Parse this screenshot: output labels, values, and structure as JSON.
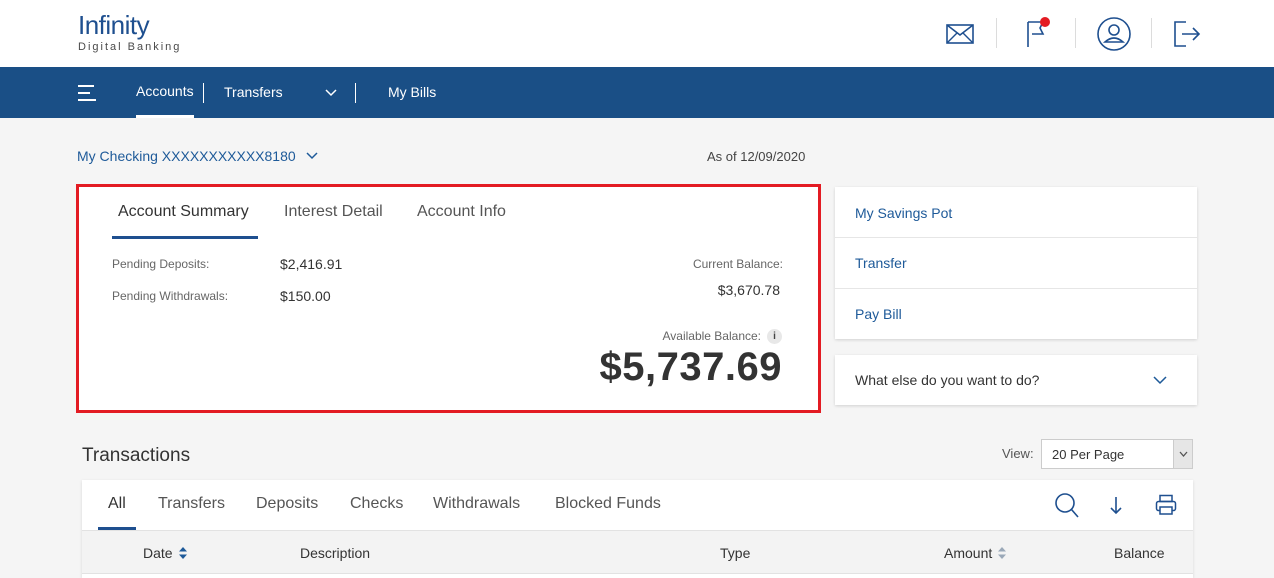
{
  "brand": {
    "name": "Infinity",
    "tagline": "Digital Banking"
  },
  "header_icons": [
    "mail-icon",
    "flag-icon",
    "user-icon",
    "logout-icon"
  ],
  "colors": {
    "primary": "#1a4f86",
    "link": "#1e5a99",
    "highlight": "#e31b23",
    "notification": "#e31b23"
  },
  "nav": {
    "accounts": "Accounts",
    "transfers": "Transfers",
    "my_bills": "My Bills"
  },
  "account": {
    "selector": "My Checking XXXXXXXXXXX8180",
    "as_of": "As of 12/09/2020"
  },
  "summary": {
    "tabs": [
      "Account Summary",
      "Interest Detail",
      "Account Info"
    ],
    "pending_deposits_label": "Pending Deposits:",
    "pending_deposits": "$2,416.91",
    "pending_withdrawals_label": "Pending Withdrawals:",
    "pending_withdrawals": "$150.00",
    "current_balance_label": "Current Balance:",
    "current_balance": "$3,670.78",
    "available_balance_label": "Available Balance:",
    "available_balance": "$5,737.69"
  },
  "quick_links": [
    "My Savings Pot",
    "Transfer",
    "Pay Bill"
  ],
  "what_else": "What else do you want to do?",
  "transactions": {
    "title": "Transactions",
    "view_label": "View:",
    "view_value": "20 Per Page",
    "tabs": [
      "All",
      "Transfers",
      "Deposits",
      "Checks",
      "Withdrawals",
      "Blocked Funds"
    ],
    "columns": [
      "Date",
      "Description",
      "Type",
      "Amount",
      "Balance"
    ]
  }
}
